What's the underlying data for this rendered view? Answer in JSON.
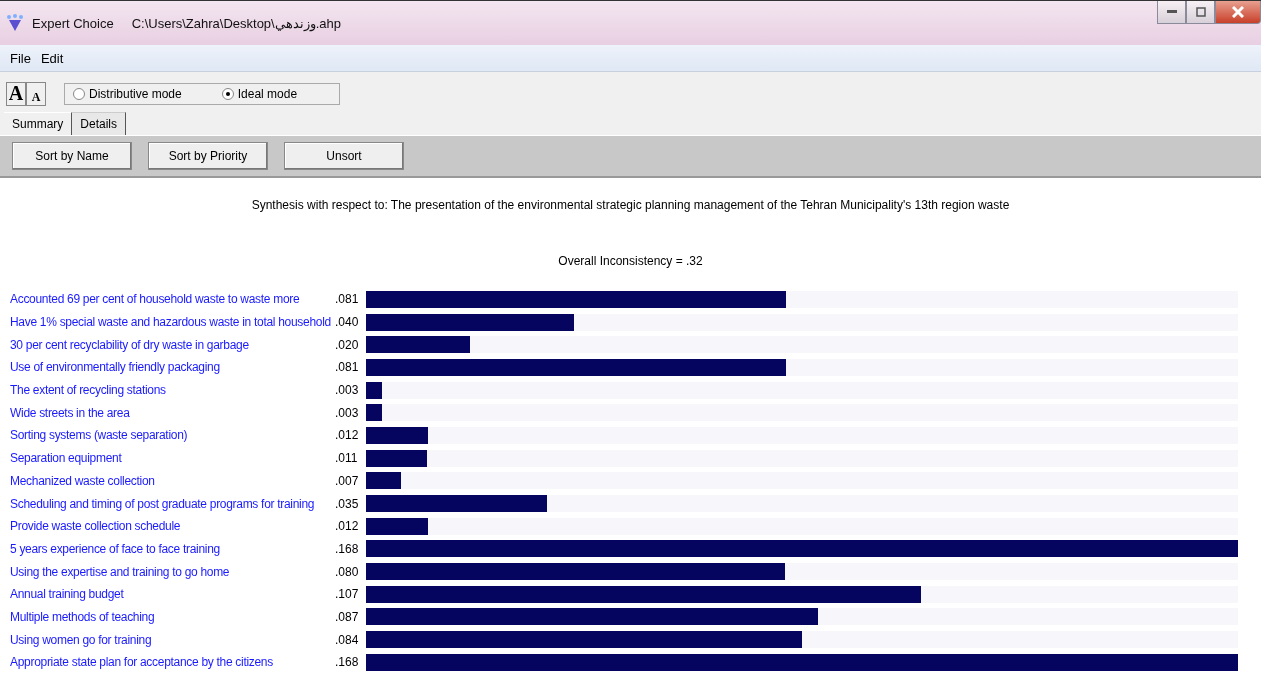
{
  "window": {
    "app": "Expert Choice",
    "title": "C:\\Users\\Zahra\\Desktop\\وزندهي.ahp"
  },
  "menu": [
    "File",
    "Edit"
  ],
  "font_buttons": [
    {
      "label": "A",
      "kind": "grow"
    },
    {
      "label": "A",
      "kind": "shrink"
    }
  ],
  "modes": [
    {
      "label": "Distributive mode",
      "selected": false
    },
    {
      "label": "Ideal mode",
      "selected": true
    }
  ],
  "tabs": [
    {
      "label": "Summary",
      "selected": true
    },
    {
      "label": "Details",
      "selected": false
    }
  ],
  "sort_buttons": [
    "Sort by Name",
    "Sort by Priority",
    "Unsort"
  ],
  "synthesis": "Synthesis with respect to: The presentation of  the environmental  strategic planning  management of  the Tehran Municipality's 13th region waste",
  "inconsistency": "Overall Inconsistency = .32",
  "rows": [
    {
      "name": "Accounted 69 per cent of household waste to waste more",
      "value": ".081",
      "level": 0.482
    },
    {
      "name": "Have 1% special waste and hazardous waste in total household",
      "value": ".040",
      "level": 0.238
    },
    {
      "name": "30 per cent recyclability of dry waste in garbage",
      "value": ".020",
      "level": 0.119
    },
    {
      "name": "Use of environmentally friendly packaging",
      "value": ".081",
      "level": 0.482
    },
    {
      "name": "The extent of recycling stations",
      "value": ".003",
      "level": 0.018
    },
    {
      "name": "Wide streets in the area",
      "value": ".003",
      "level": 0.018
    },
    {
      "name": "Sorting systems (waste separation)",
      "value": ".012",
      "level": 0.071
    },
    {
      "name": "Separation equipment",
      "value": ".011",
      "level": 0.07
    },
    {
      "name": "Mechanized waste collection",
      "value": ".007",
      "level": 0.04
    },
    {
      "name": "Scheduling and timing of post graduate programs for training",
      "value": ".035",
      "level": 0.208
    },
    {
      "name": "Provide waste collection schedule",
      "value": ".012",
      "level": 0.071
    },
    {
      "name": "5 years experience of face to face training",
      "value": ".168",
      "level": 1
    },
    {
      "name": "Using the expertise and training to go home",
      "value": ".080",
      "level": 0.48
    },
    {
      "name": "Annual training budget",
      "value": ".107",
      "level": 0.637
    },
    {
      "name": "Multiple methods of teaching",
      "value": ".087",
      "level": 0.518
    },
    {
      "name": "Using women go for training",
      "value": ".084",
      "level": 0.5
    },
    {
      "name": "Appropriate state plan for acceptance by the citizens",
      "value": ".168",
      "level": 1
    }
  ]
}
